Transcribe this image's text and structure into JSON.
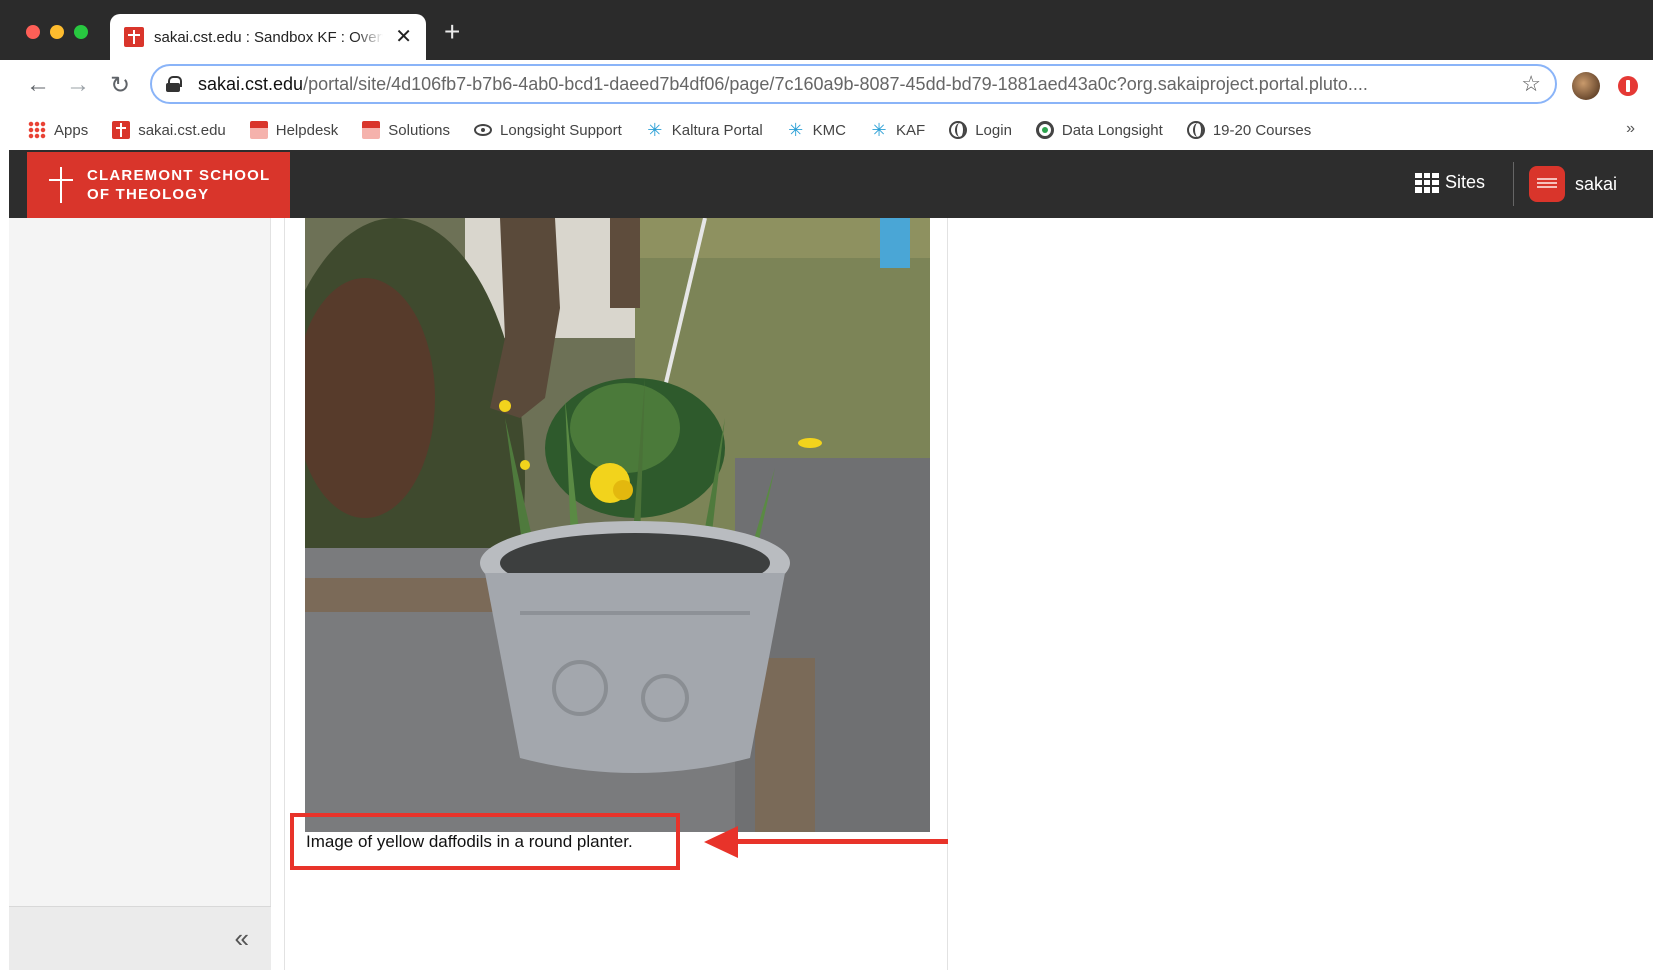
{
  "browser": {
    "tab_title": "sakai.cst.edu : Sandbox KF : Overview",
    "url_host": "sakai.cst.edu",
    "url_path": "/portal/site/4d106fb7-b7b6-4ab0-bcd1-daeed7b4df06/page/7c160a9b-8087-45dd-bd79-1881aed43a0c?org.sakaiproject.portal.pluto....",
    "new_tab_label": "+",
    "close_label": "✕",
    "back_label": "←",
    "forward_label": "→",
    "reload_label": "↻",
    "star_label": "☆"
  },
  "bookmarks": {
    "items": [
      {
        "label": "Apps",
        "icon": "apps-icon"
      },
      {
        "label": "sakai.cst.edu",
        "icon": "sakai-icon"
      },
      {
        "label": "Helpdesk",
        "icon": "helpdesk-icon"
      },
      {
        "label": "Solutions",
        "icon": "solutions-icon"
      },
      {
        "label": "Longsight Support",
        "icon": "eye-icon"
      },
      {
        "label": "Kaltura Portal",
        "icon": "kaltura-icon"
      },
      {
        "label": "KMC",
        "icon": "kaltura-icon"
      },
      {
        "label": "KAF",
        "icon": "kaltura-icon"
      },
      {
        "label": "Login",
        "icon": "globe-icon"
      },
      {
        "label": "Data Longsight",
        "icon": "target-icon"
      },
      {
        "label": "19-20 Courses",
        "icon": "globe-icon"
      }
    ],
    "more_label": "»"
  },
  "header": {
    "brand_line1": "Claremont School",
    "brand_line2": "of Theology",
    "sites_label": "Sites",
    "user_label": "sakai"
  },
  "sidebar": {
    "collapse_label": "«"
  },
  "main": {
    "caption": "Image of yellow daffodils in a round planter."
  },
  "colors": {
    "brand_red": "#d9352b",
    "header_bg": "#2d2d2d",
    "annotation_red": "#e8332a"
  }
}
